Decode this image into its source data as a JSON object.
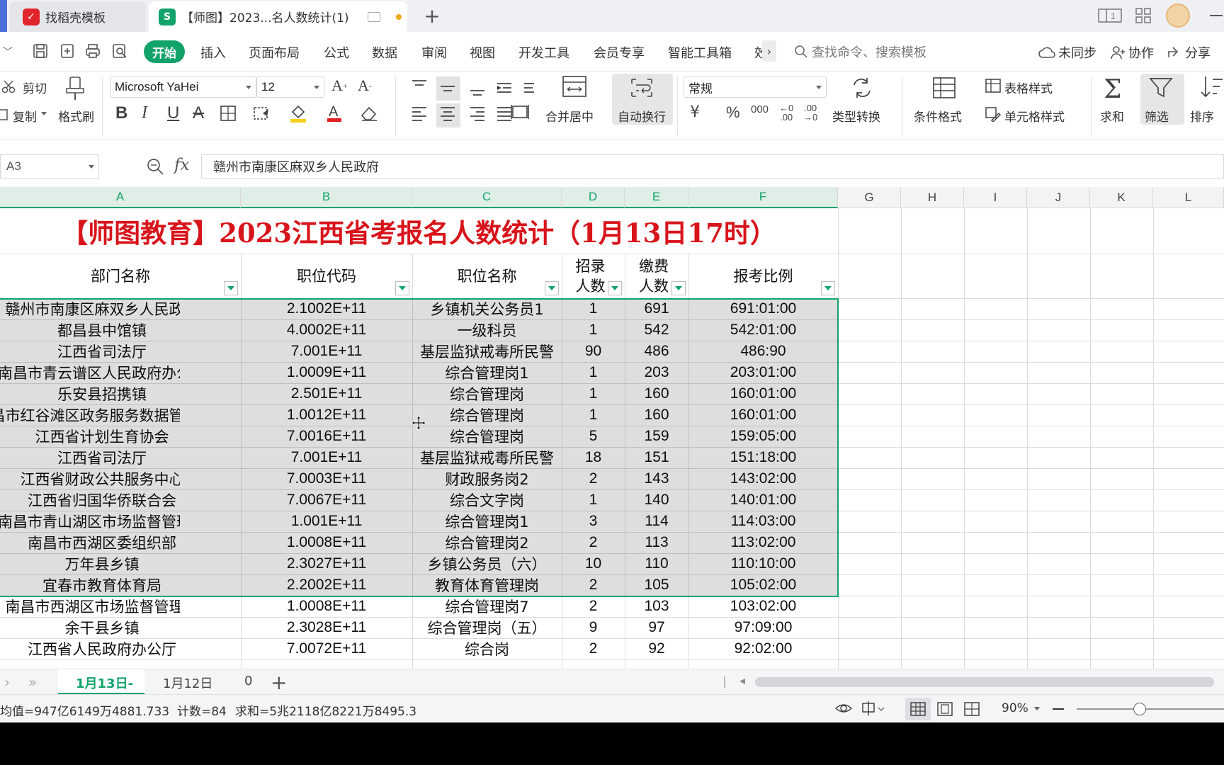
{
  "tabs": {
    "inactive": "找稻壳模板",
    "active": "【师图】2023...名人数统计(1)"
  },
  "menu": {
    "start": "开始",
    "items": [
      "插入",
      "页面布局",
      "公式",
      "数据",
      "审阅",
      "视图",
      "开发工具",
      "会员专享",
      "智能工具箱",
      "效"
    ],
    "search_placeholder": "查找命令、搜索模板",
    "sync": "未同步",
    "collab": "协作",
    "share": "分享"
  },
  "ribbon": {
    "cut": "剪切",
    "copy": "复制",
    "format_painter": "格式刷",
    "font_name": "Microsoft YaHei",
    "font_size": "12",
    "merge_center": "合并居中",
    "wrap_text": "自动换行",
    "number_format": "常规",
    "type_convert": "类型转换",
    "conditional_format": "条件格式",
    "table_style": "表格样式",
    "cell_style": "单元格样式",
    "sum": "求和",
    "filter": "筛选",
    "sort": "排序"
  },
  "formula_bar": {
    "cell_ref": "A3",
    "fx": "fx",
    "value": "赣州市南康区麻双乡人民政府"
  },
  "columns": [
    "A",
    "B",
    "C",
    "D",
    "E",
    "F",
    "G",
    "H",
    "I",
    "J",
    "K",
    "L"
  ],
  "sheet": {
    "title": "【师图教育】2023江西省考报名人数统计（1月13日17时）",
    "headers": [
      "部门名称",
      "职位代码",
      "职位名称",
      "招录人数",
      "缴费人数",
      "报考比例"
    ],
    "rows": [
      [
        "赣州市南康区麻双乡人民政府",
        "2.1002E+11",
        "乡镇机关公务员1",
        "1",
        "691",
        "691:01:00"
      ],
      [
        "都昌县中馆镇",
        "4.0002E+11",
        "一级科员",
        "1",
        "542",
        "542:01:00"
      ],
      [
        "江西省司法厅",
        "7.001E+11",
        "基层监狱戒毒所民警",
        "90",
        "486",
        "486:90"
      ],
      [
        "南昌市青云谱区人民政府办公室",
        "1.0009E+11",
        "综合管理岗1",
        "1",
        "203",
        "203:01:00"
      ],
      [
        "乐安县招携镇",
        "2.501E+11",
        "综合管理岗",
        "1",
        "160",
        "160:01:00"
      ],
      [
        "昌市红谷滩区政务服务数据管理局",
        "1.0012E+11",
        "综合管理岗",
        "1",
        "160",
        "160:01:00"
      ],
      [
        "江西省计划生育协会",
        "7.0016E+11",
        "综合管理岗",
        "5",
        "159",
        "159:05:00"
      ],
      [
        "江西省司法厅",
        "7.001E+11",
        "基层监狱戒毒所民警",
        "18",
        "151",
        "151:18:00"
      ],
      [
        "江西省财政公共服务中心",
        "7.0003E+11",
        "财政服务岗2",
        "2",
        "143",
        "143:02:00"
      ],
      [
        "江西省归国华侨联合会",
        "7.0067E+11",
        "综合文字岗",
        "1",
        "140",
        "140:01:00"
      ],
      [
        "南昌市青山湖区市场监督管理局",
        "1.001E+11",
        "综合管理岗1",
        "3",
        "114",
        "114:03:00"
      ],
      [
        "南昌市西湖区委组织部",
        "1.0008E+11",
        "综合管理岗2",
        "2",
        "113",
        "113:02:00"
      ],
      [
        "万年县乡镇",
        "2.3027E+11",
        "乡镇公务员（六）",
        "10",
        "110",
        "110:10:00"
      ],
      [
        "宜春市教育体育局",
        "2.2002E+11",
        "教育体育管理岗",
        "2",
        "105",
        "105:02:00"
      ],
      [
        "南昌市西湖区市场监督管理局",
        "1.0008E+11",
        "综合管理岗7",
        "2",
        "103",
        "103:02:00"
      ],
      [
        "余干县乡镇",
        "2.3028E+11",
        "综合管理岗（五）",
        "9",
        "97",
        "97:09:00"
      ],
      [
        "江西省人民政府办公厅",
        "7.0072E+11",
        "综合岗",
        "2",
        "92",
        "92:02:00"
      ]
    ]
  },
  "sheet_tabs": [
    "1月13日-",
    "1月12日",
    "0"
  ],
  "status": {
    "average": "均值=947亿6149万4881.733",
    "count": "计数=84",
    "sum": "求和=5兆2118亿8221万8495.3",
    "zoom": "90%"
  },
  "colors": {
    "accent": "#12a36a",
    "title_red": "#d8141b",
    "selection_border": "#12a36a"
  }
}
